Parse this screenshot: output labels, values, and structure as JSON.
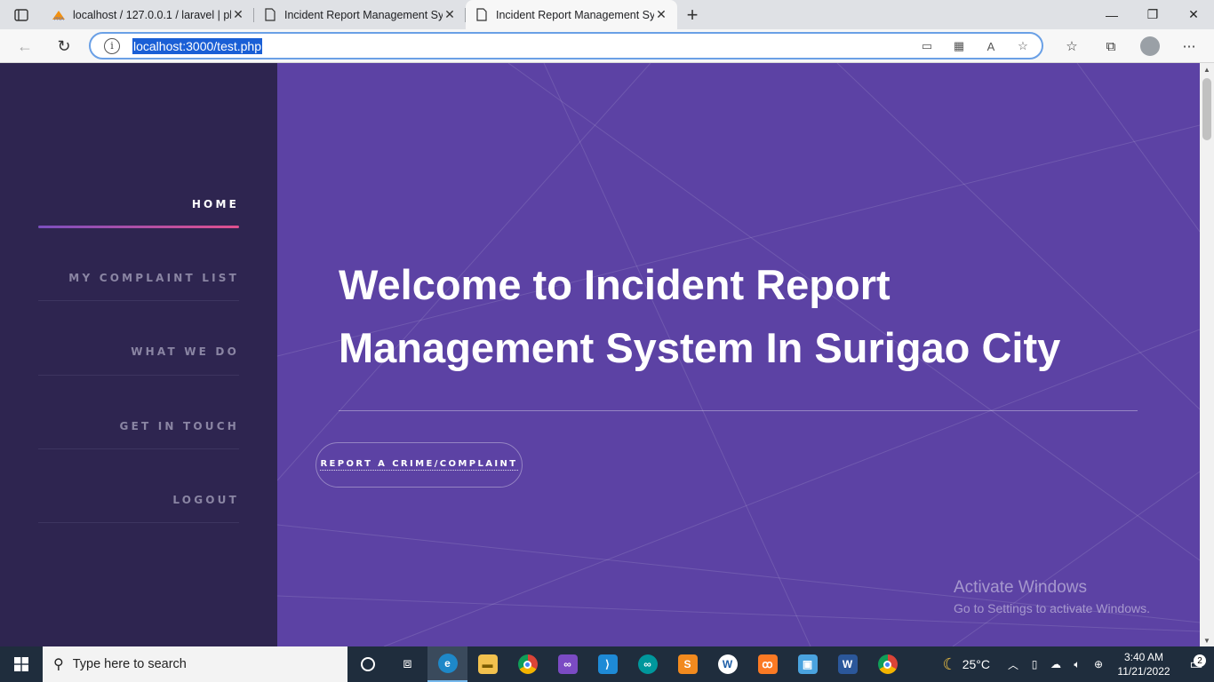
{
  "browser": {
    "tabs": [
      {
        "title": "localhost / 127.0.0.1 / laravel | ph",
        "icon": "phpmyadmin-icon",
        "active": false
      },
      {
        "title": "Incident Report Management Sy",
        "icon": "page-icon",
        "active": false
      },
      {
        "title": "Incident Report Management Sy",
        "icon": "page-icon",
        "active": true
      }
    ],
    "url": "localhost:3000/test.php"
  },
  "sidebar": {
    "items": [
      {
        "label": "HOME",
        "active": true
      },
      {
        "label": "MY COMPLAINT LIST",
        "active": false
      },
      {
        "label": "WHAT WE DO",
        "active": false
      },
      {
        "label": "GET IN TOUCH",
        "active": false
      },
      {
        "label": "LOGOUT",
        "active": false
      }
    ]
  },
  "main": {
    "headline_line1": "Welcome to Incident Report",
    "headline_line2": "Management System In Surigao City",
    "cta_label": "REPORT A CRIME/COMPLAINT"
  },
  "watermark": {
    "title": "Activate Windows",
    "subtitle": "Go to Settings to activate Windows."
  },
  "taskbar": {
    "search_placeholder": "Type here to search",
    "weather": "25°C",
    "time": "3:40 AM",
    "date": "11/21/2022",
    "notifications": "2"
  },
  "colors": {
    "sidebar_bg": "#2e2550",
    "main_bg": "#5c42a4",
    "accent_gradient_start": "#7c4fbf",
    "accent_gradient_end": "#e0508e"
  }
}
